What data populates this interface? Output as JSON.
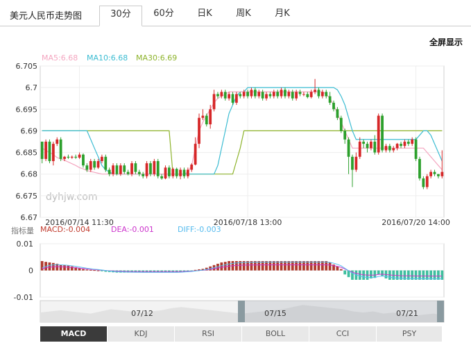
{
  "header": {
    "title": "美元人民币走势图",
    "tabs": [
      {
        "label": "30分",
        "active": true
      },
      {
        "label": "60分",
        "active": false
      },
      {
        "label": "日K",
        "active": false
      },
      {
        "label": "周K",
        "active": false
      },
      {
        "label": "月K",
        "active": false
      }
    ],
    "fullscreen_label": "全屏显示"
  },
  "watermark": "dyhjw.com",
  "ma_legend": {
    "ma5": "MA5:6.68",
    "ma10": "MA10:6.68",
    "ma30": "MA30:6.69"
  },
  "indicator_legend": {
    "label": "指标量",
    "macd": "MACD:-0.004",
    "dea": "DEA:-0.001",
    "diff": "DIFF:-0.003"
  },
  "indicator_buttons": [
    "MACD",
    "KDJ",
    "RSI",
    "BOLL",
    "CCI",
    "PSY"
  ],
  "active_indicator": "MACD",
  "navigator_labels": [
    "07/12",
    "07/15",
    "07/21"
  ],
  "colors": {
    "up": "#d62728",
    "down": "#2ca02c",
    "ma5": "#f4a6c0",
    "ma10": "#3bbcd2",
    "ma30": "#8db32b",
    "macd_pos": "#b03a2e",
    "macd_neg": "#3fbf9f",
    "dea": "#cc33cc",
    "diff": "#55bbee"
  },
  "chart_data": [
    {
      "type": "candlestick",
      "title": "美元人民币走势图",
      "interval": "30分",
      "ylim": [
        6.67,
        6.705
      ],
      "y_ticks": [
        "6.705",
        "6.7",
        "6.695",
        "6.69",
        "6.685",
        "6.68",
        "6.675",
        "6.67"
      ],
      "x_tick_labels": [
        {
          "index": 10,
          "label": "2016/07/14 11:30"
        },
        {
          "index": 55,
          "label": "2016/07/18 13:00"
        },
        {
          "index": 100,
          "label": "2016/07/20 14:00"
        }
      ],
      "candles": [
        [
          6.6875,
          6.6835,
          6.6875,
          6.6825
        ],
        [
          6.6835,
          6.6875,
          6.688,
          6.683
        ],
        [
          6.6875,
          6.683,
          6.688,
          6.6825
        ],
        [
          6.683,
          6.687,
          6.6875,
          6.682
        ],
        [
          6.687,
          6.688,
          6.6885,
          6.6865
        ],
        [
          6.688,
          6.6835,
          6.6885,
          6.683
        ],
        [
          6.6835,
          6.684,
          6.6842,
          6.683
        ],
        [
          6.684,
          6.6838,
          6.6845,
          6.6835
        ],
        [
          6.6838,
          6.684,
          6.6843,
          6.6835
        ],
        [
          6.684,
          6.6838,
          6.6845,
          6.6835
        ],
        [
          6.6838,
          6.6845,
          6.685,
          6.6835
        ],
        [
          6.6845,
          6.682,
          6.6848,
          6.6815
        ],
        [
          6.682,
          6.681,
          6.6825,
          6.6805
        ],
        [
          6.681,
          6.683,
          6.6835,
          6.6805
        ],
        [
          6.683,
          6.6815,
          6.6835,
          6.681
        ],
        [
          6.6815,
          6.683,
          6.6835,
          6.6812
        ],
        [
          6.683,
          6.684,
          6.6845,
          6.6825
        ],
        [
          6.684,
          6.681,
          6.6845,
          6.6805
        ],
        [
          6.681,
          6.68,
          6.6815,
          6.6795
        ],
        [
          6.68,
          6.682,
          6.6825,
          6.6795
        ],
        [
          6.682,
          6.68,
          6.6825,
          6.6797
        ],
        [
          6.68,
          6.682,
          6.6825,
          6.6796
        ],
        [
          6.682,
          6.6805,
          6.6825,
          6.68
        ],
        [
          6.6805,
          6.68,
          6.681,
          6.6797
        ],
        [
          6.68,
          6.6825,
          6.683,
          6.6795
        ],
        [
          6.6825,
          6.6805,
          6.683,
          6.68
        ],
        [
          6.6805,
          6.68,
          6.681,
          6.6795
        ],
        [
          6.68,
          6.6795,
          6.6805,
          6.679
        ],
        [
          6.6795,
          6.6825,
          6.683,
          6.679
        ],
        [
          6.6825,
          6.68,
          6.683,
          6.6795
        ],
        [
          6.68,
          6.683,
          6.6835,
          6.6795
        ],
        [
          6.683,
          6.6795,
          6.6835,
          6.679
        ],
        [
          6.6795,
          6.679,
          6.68,
          6.6787
        ],
        [
          6.679,
          6.6815,
          6.682,
          6.6788
        ],
        [
          6.6815,
          6.6795,
          6.682,
          6.679
        ],
        [
          6.6795,
          6.6812,
          6.6815,
          6.679
        ],
        [
          6.6812,
          6.6795,
          6.6815,
          6.679
        ],
        [
          6.6795,
          6.681,
          6.6815,
          6.6788
        ],
        [
          6.681,
          6.6795,
          6.6815,
          6.679
        ],
        [
          6.6795,
          6.681,
          6.6815,
          6.679
        ],
        [
          6.681,
          6.6822,
          6.6825,
          6.6805
        ],
        [
          6.6822,
          6.687,
          6.6885,
          6.682
        ],
        [
          6.687,
          6.693,
          6.694,
          6.686
        ],
        [
          6.693,
          6.6935,
          6.695,
          6.6925
        ],
        [
          6.6935,
          6.6915,
          6.694,
          6.691
        ],
        [
          6.6915,
          6.695,
          6.696,
          6.6905
        ],
        [
          6.695,
          6.6985,
          6.6995,
          6.6945
        ],
        [
          6.6985,
          6.698,
          6.699,
          6.6975
        ],
        [
          6.698,
          6.699,
          6.6995,
          6.6975
        ],
        [
          6.699,
          6.6975,
          6.6995,
          6.697
        ],
        [
          6.6975,
          6.6985,
          6.699,
          6.697
        ],
        [
          6.6985,
          6.6965,
          6.699,
          6.696
        ],
        [
          6.6965,
          6.6985,
          6.699,
          6.696
        ],
        [
          6.6985,
          6.698,
          6.699,
          6.6975
        ],
        [
          6.698,
          6.699,
          6.6995,
          6.6975
        ],
        [
          6.699,
          6.698,
          6.6995,
          6.6975
        ],
        [
          6.698,
          6.6995,
          6.7,
          6.6975
        ],
        [
          6.6995,
          6.698,
          6.7,
          6.6975
        ],
        [
          6.698,
          6.699,
          6.6995,
          6.6975
        ],
        [
          6.699,
          6.6975,
          6.6995,
          6.697
        ],
        [
          6.6975,
          6.6985,
          6.699,
          6.697
        ],
        [
          6.6985,
          6.698,
          6.699,
          6.6975
        ],
        [
          6.698,
          6.699,
          6.6995,
          6.6975
        ],
        [
          6.699,
          6.698,
          6.6995,
          6.6975
        ],
        [
          6.698,
          6.6995,
          6.7,
          6.6975
        ],
        [
          6.6995,
          6.698,
          6.7,
          6.6975
        ],
        [
          6.698,
          6.699,
          6.6995,
          6.6975
        ],
        [
          6.699,
          6.6975,
          6.6995,
          6.697
        ],
        [
          6.6975,
          6.699,
          6.6995,
          6.697
        ],
        [
          6.699,
          6.6985,
          6.6995,
          6.698
        ],
        [
          6.6985,
          6.6985,
          6.699,
          6.698
        ],
        [
          6.6985,
          6.6978,
          6.699,
          6.6975
        ],
        [
          6.6978,
          6.699,
          6.6995,
          6.6975
        ],
        [
          6.699,
          6.6995,
          6.702,
          6.6985
        ],
        [
          6.6995,
          6.698,
          6.7,
          6.6975
        ],
        [
          6.698,
          6.699,
          6.6995,
          6.6975
        ],
        [
          6.699,
          6.698,
          6.6995,
          6.6975
        ],
        [
          6.698,
          6.6965,
          6.699,
          6.696
        ],
        [
          6.6965,
          6.695,
          6.697,
          6.6945
        ],
        [
          6.695,
          6.693,
          6.6955,
          6.6925
        ],
        [
          6.693,
          6.69,
          6.6935,
          6.6895
        ],
        [
          6.69,
          6.688,
          6.6905,
          6.687
        ],
        [
          6.688,
          6.684,
          6.6885,
          6.68
        ],
        [
          6.684,
          6.681,
          6.6845,
          6.677
        ],
        [
          6.681,
          6.684,
          6.685,
          6.6805
        ],
        [
          6.684,
          6.6875,
          6.6885,
          6.6835
        ],
        [
          6.6875,
          6.687,
          6.688,
          6.686
        ],
        [
          6.687,
          6.686,
          6.6875,
          6.685
        ],
        [
          6.686,
          6.6875,
          6.688,
          6.6855
        ],
        [
          6.6875,
          6.685,
          6.689,
          6.6845
        ],
        [
          6.685,
          6.6935,
          6.694,
          6.6845
        ],
        [
          6.6935,
          6.6855,
          6.694,
          6.685
        ],
        [
          6.6855,
          6.6865,
          6.687,
          6.685
        ],
        [
          6.6865,
          6.6855,
          6.687,
          6.685
        ],
        [
          6.6855,
          6.686,
          6.6865,
          6.685
        ],
        [
          6.686,
          6.687,
          6.6872,
          6.6855
        ],
        [
          6.687,
          6.6865,
          6.6875,
          6.686
        ],
        [
          6.6865,
          6.6875,
          6.688,
          6.686
        ],
        [
          6.6875,
          6.687,
          6.688,
          6.6865
        ],
        [
          6.687,
          6.688,
          6.6885,
          6.6865
        ],
        [
          6.688,
          6.6835,
          6.6885,
          6.683
        ],
        [
          6.6835,
          6.679,
          6.684,
          6.6785
        ],
        [
          6.679,
          6.677,
          6.6795,
          6.6765
        ],
        [
          6.677,
          6.6795,
          6.68,
          6.6765
        ],
        [
          6.6795,
          6.6805,
          6.681,
          6.679
        ],
        [
          6.6805,
          6.68,
          6.681,
          6.6795
        ],
        [
          6.68,
          6.6795,
          6.68,
          6.679
        ],
        [
          6.6795,
          6.6805,
          6.6855,
          6.679
        ]
      ],
      "ma5": [
        6.686,
        6.6855,
        6.685,
        6.6845,
        6.6838,
        6.6835,
        6.6832,
        6.6828,
        6.6824,
        6.682,
        6.6815,
        6.6812,
        6.6808,
        6.6806,
        6.6804,
        6.6802,
        6.68,
        6.68,
        6.68,
        6.68,
        6.68,
        6.68,
        6.68,
        6.68,
        6.68,
        6.68,
        6.68,
        6.68,
        6.68,
        6.68,
        6.68,
        6.68,
        6.68,
        6.68,
        6.68,
        6.68,
        6.68,
        6.68,
        6.68,
        6.6805,
        6.682,
        6.686,
        6.69,
        6.692,
        6.6935,
        6.695,
        6.6965,
        6.6975,
        6.698,
        6.6985,
        6.699,
        6.699,
        6.699,
        6.699,
        6.699,
        6.699,
        6.699,
        6.699,
        6.699,
        6.699,
        6.699,
        6.699,
        6.699,
        6.699,
        6.699,
        6.699,
        6.699,
        6.699,
        6.699,
        6.699,
        6.699,
        6.699,
        6.699,
        6.699,
        6.699,
        6.699,
        6.6985,
        6.6975,
        6.696,
        6.694,
        6.692,
        6.69,
        6.688,
        6.686,
        6.686,
        6.686,
        6.686,
        6.686,
        6.686,
        6.686,
        6.686,
        6.686,
        6.686,
        6.686,
        6.686,
        6.686,
        6.686,
        6.686,
        6.686,
        6.686,
        6.686,
        6.686,
        6.686,
        6.685,
        6.684,
        6.683,
        6.682,
        6.681
      ],
      "ma10": [
        6.69,
        6.69,
        6.69,
        6.69,
        6.69,
        6.69,
        6.69,
        6.69,
        6.69,
        6.69,
        6.69,
        6.69,
        6.69,
        6.688,
        6.686,
        6.684,
        6.682,
        6.681,
        6.6805,
        6.68,
        6.68,
        6.68,
        6.68,
        6.68,
        6.68,
        6.68,
        6.68,
        6.68,
        6.68,
        6.68,
        6.68,
        6.68,
        6.68,
        6.68,
        6.68,
        6.68,
        6.68,
        6.68,
        6.68,
        6.68,
        6.68,
        6.68,
        6.68,
        6.68,
        6.68,
        6.68,
        6.68,
        6.682,
        6.686,
        6.69,
        6.694,
        6.696,
        6.698,
        6.699,
        6.699,
        6.7,
        6.7,
        6.7,
        6.7,
        6.7,
        6.7,
        6.7,
        6.7,
        6.7,
        6.7,
        6.7,
        6.7,
        6.7,
        6.7,
        6.7,
        6.7,
        6.7,
        6.7,
        6.7,
        6.7,
        6.7,
        6.7,
        6.7,
        6.7,
        6.6995,
        6.698,
        6.696,
        6.693,
        6.69,
        6.688,
        6.688,
        6.688,
        6.688,
        6.688,
        6.688,
        6.688,
        6.688,
        6.688,
        6.688,
        6.688,
        6.688,
        6.688,
        6.688,
        6.688,
        6.688,
        6.688,
        6.689,
        6.69,
        6.69,
        6.689,
        6.687,
        6.685,
        6.683
      ],
      "ma30": [
        6.69,
        6.69,
        6.69,
        6.69,
        6.69,
        6.69,
        6.69,
        6.69,
        6.69,
        6.69,
        6.69,
        6.69,
        6.69,
        6.69,
        6.69,
        6.69,
        6.69,
        6.69,
        6.69,
        6.69,
        6.69,
        6.69,
        6.69,
        6.69,
        6.69,
        6.69,
        6.69,
        6.69,
        6.69,
        6.69,
        6.69,
        6.69,
        6.69,
        6.69,
        6.69,
        6.68,
        6.68,
        6.68,
        6.68,
        6.68,
        6.68,
        6.68,
        6.68,
        6.68,
        6.68,
        6.68,
        6.68,
        6.68,
        6.68,
        6.68,
        6.68,
        6.68,
        6.683,
        6.686,
        6.69,
        6.69,
        6.69,
        6.69,
        6.69,
        6.69,
        6.69,
        6.69,
        6.69,
        6.69,
        6.69,
        6.69,
        6.69,
        6.69,
        6.69,
        6.69,
        6.69,
        6.69,
        6.69,
        6.69,
        6.69,
        6.69,
        6.69,
        6.69,
        6.69,
        6.69,
        6.69,
        6.69,
        6.69,
        6.69,
        6.69,
        6.69,
        6.69,
        6.69,
        6.69,
        6.69,
        6.69,
        6.69,
        6.69,
        6.69,
        6.69,
        6.69,
        6.69,
        6.69,
        6.69,
        6.69,
        6.69,
        6.69,
        6.69,
        6.69,
        6.69,
        6.69,
        6.69,
        6.69
      ]
    },
    {
      "type": "bar",
      "title": "MACD",
      "ylim": [
        -0.01,
        0.01
      ],
      "y_ticks": [
        "0.01",
        "0",
        "-0.01"
      ],
      "macd": [
        0.0035,
        0.0032,
        0.003,
        0.0028,
        0.0025,
        0.0022,
        0.002,
        0.0018,
        0.0015,
        0.0012,
        0.0008,
        0.0005,
        0.0003,
        0.0002,
        0.0001,
        0.0,
        -0.0003,
        -0.0005,
        -0.0006,
        -0.0007,
        -0.0008,
        -0.0008,
        -0.0008,
        -0.0008,
        -0.0008,
        -0.0008,
        -0.0008,
        -0.0008,
        -0.0008,
        -0.0008,
        -0.0008,
        -0.0008,
        -0.0008,
        -0.0008,
        -0.0008,
        -0.0008,
        -0.0008,
        -0.0006,
        -0.0004,
        -0.0003,
        -0.0002,
        0.0002,
        0.0004,
        0.0006,
        0.001,
        0.0015,
        0.002,
        0.0025,
        0.003,
        0.0032,
        0.0035,
        0.0035,
        0.0035,
        0.0035,
        0.0035,
        0.0035,
        0.0035,
        0.0035,
        0.0035,
        0.0035,
        0.0035,
        0.0035,
        0.0035,
        0.0035,
        0.0035,
        0.0035,
        0.0035,
        0.0035,
        0.0035,
        0.0035,
        0.0035,
        0.0035,
        0.0035,
        0.0035,
        0.0035,
        0.0035,
        0.0035,
        0.003,
        0.0022,
        0.0015,
        0.0005,
        -0.0015,
        -0.0025,
        -0.0035,
        -0.0035,
        -0.0035,
        -0.0035,
        -0.0035,
        -0.003,
        -0.0028,
        -0.0015,
        -0.002,
        -0.003,
        -0.0035,
        -0.0035,
        -0.0035,
        -0.0035,
        -0.0035,
        -0.0035,
        -0.0035,
        -0.0035,
        -0.0035,
        -0.0035,
        -0.0035,
        -0.0035,
        -0.0035,
        -0.0035,
        -0.0035
      ]
    }
  ]
}
